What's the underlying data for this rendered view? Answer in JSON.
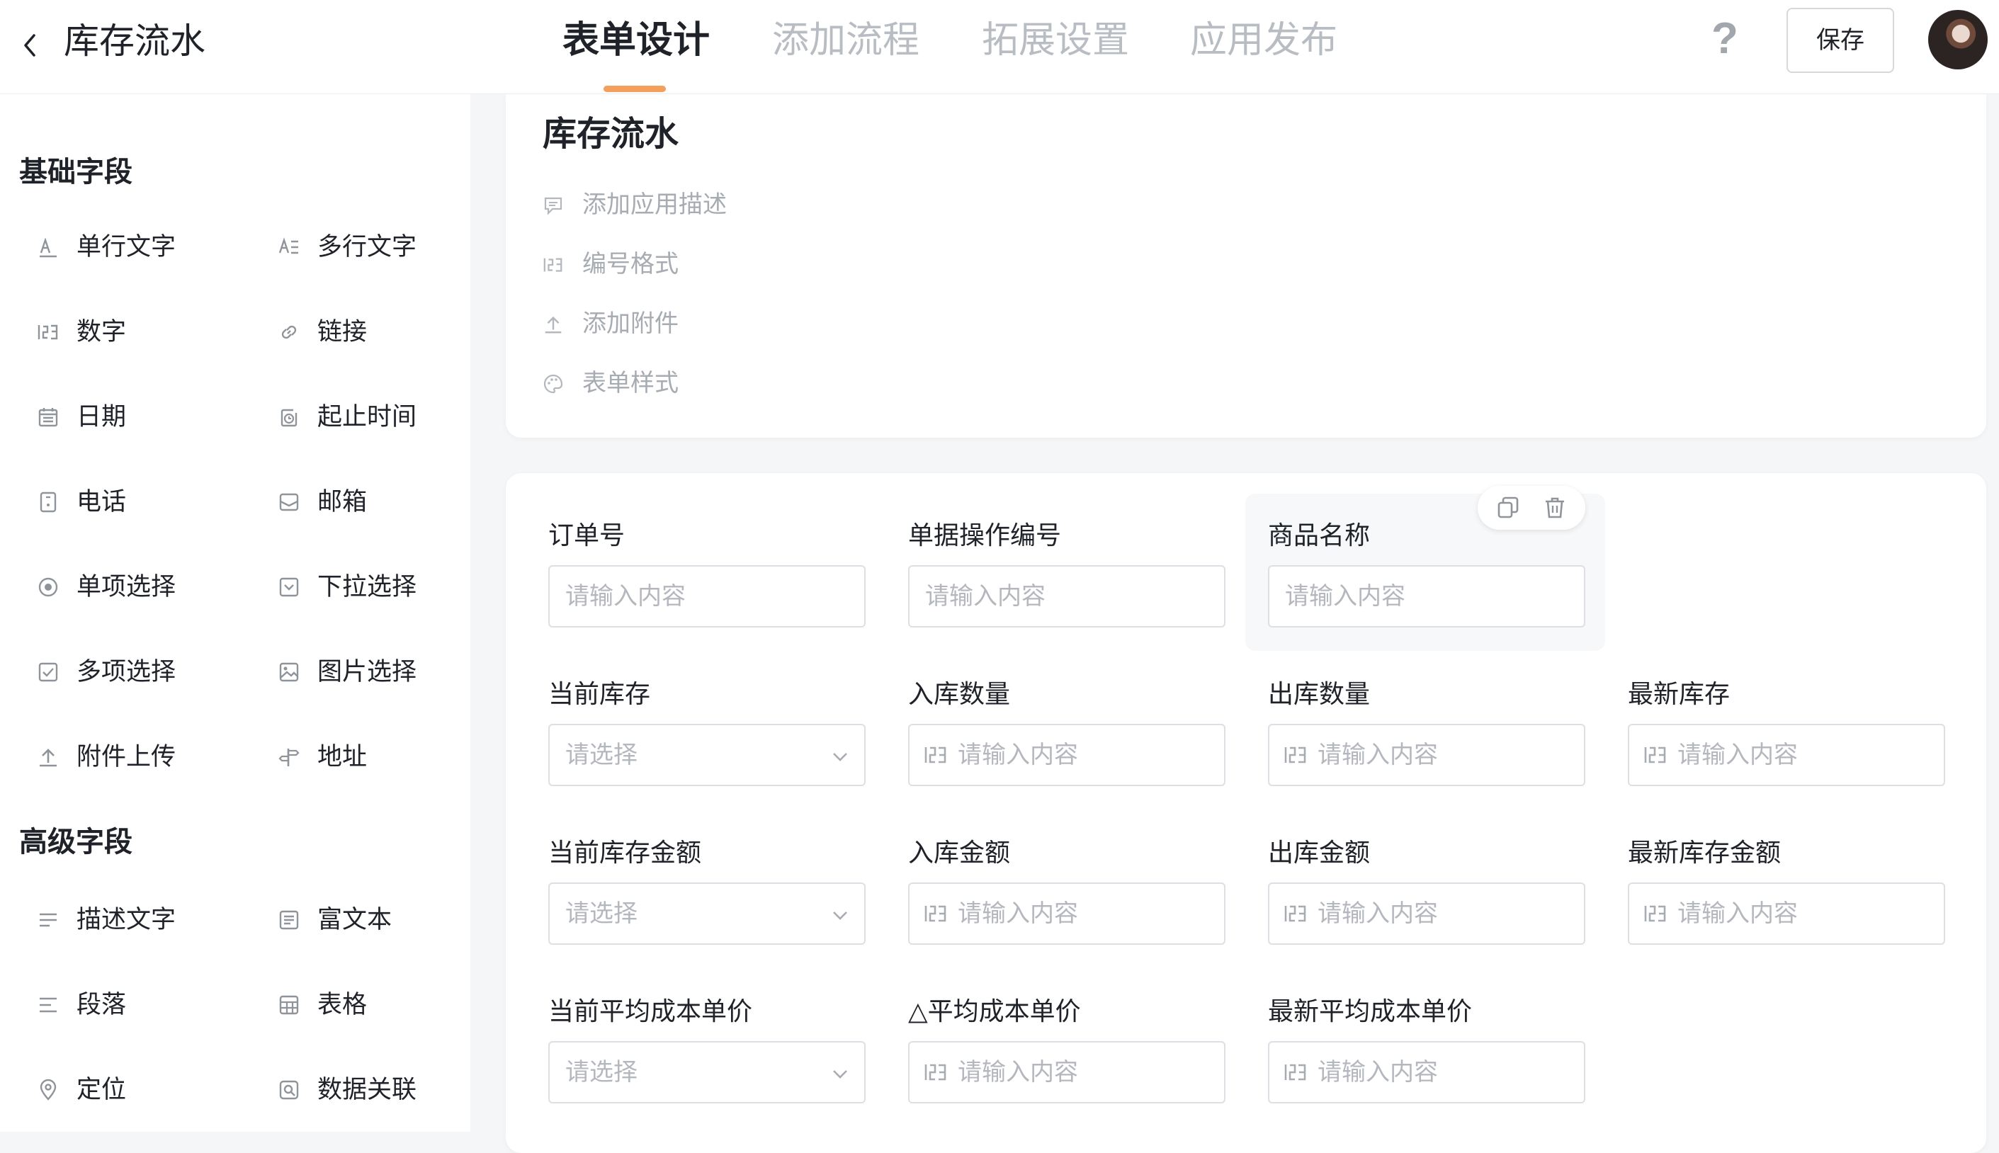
{
  "header": {
    "back_label": "",
    "app_title": "库存流水",
    "tabs": [
      {
        "label": "表单设计",
        "active": true
      },
      {
        "label": "添加流程",
        "active": false
      },
      {
        "label": "拓展设置",
        "active": false
      },
      {
        "label": "应用发布",
        "active": false
      }
    ],
    "help_label": "?",
    "save_label": "保存"
  },
  "sidebar": {
    "basic_title": "基础字段",
    "basic_items": [
      {
        "label": "单行文字",
        "icon": "single-line-text-icon"
      },
      {
        "label": "多行文字",
        "icon": "multi-line-text-icon"
      },
      {
        "label": "数字",
        "icon": "number-icon"
      },
      {
        "label": "链接",
        "icon": "link-icon"
      },
      {
        "label": "日期",
        "icon": "date-icon"
      },
      {
        "label": "起止时间",
        "icon": "time-range-icon"
      },
      {
        "label": "电话",
        "icon": "phone-icon"
      },
      {
        "label": "邮箱",
        "icon": "mail-icon"
      },
      {
        "label": "单项选择",
        "icon": "radio-icon"
      },
      {
        "label": "下拉选择",
        "icon": "dropdown-icon"
      },
      {
        "label": "多项选择",
        "icon": "checkbox-icon"
      },
      {
        "label": "图片选择",
        "icon": "image-icon"
      },
      {
        "label": "附件上传",
        "icon": "upload-icon"
      },
      {
        "label": "地址",
        "icon": "signpost-icon"
      }
    ],
    "advanced_title": "高级字段",
    "advanced_items": [
      {
        "label": "描述文字",
        "icon": "description-icon"
      },
      {
        "label": "富文本",
        "icon": "rich-text-icon"
      },
      {
        "label": "段落",
        "icon": "paragraph-icon"
      },
      {
        "label": "表格",
        "icon": "table-icon"
      },
      {
        "label": "定位",
        "icon": "location-pin-icon"
      },
      {
        "label": "数据关联",
        "icon": "data-link-icon"
      }
    ]
  },
  "form_header": {
    "title": "库存流水",
    "meta_items": [
      {
        "label": "添加应用描述",
        "icon": "comment-icon"
      },
      {
        "label": "编号格式",
        "icon": "number-icon"
      },
      {
        "label": "添加附件",
        "icon": "upload-icon"
      },
      {
        "label": "表单样式",
        "icon": "palette-icon"
      }
    ]
  },
  "form_fields": [
    {
      "label": "订单号",
      "type": "text",
      "placeholder": "请输入内容"
    },
    {
      "label": "单据操作编号",
      "type": "text",
      "placeholder": "请输入内容"
    },
    {
      "label": "商品名称",
      "type": "text",
      "placeholder": "请输入内容",
      "selected": true
    },
    {
      "label": "当前库存",
      "type": "select",
      "placeholder": "请选择"
    },
    {
      "label": "入库数量",
      "type": "number",
      "placeholder": "请输入内容"
    },
    {
      "label": "出库数量",
      "type": "number",
      "placeholder": "请输入内容"
    },
    {
      "label": "最新库存",
      "type": "number",
      "placeholder": "请输入内容"
    },
    {
      "label": "当前库存金额",
      "type": "select",
      "placeholder": "请选择"
    },
    {
      "label": "入库金额",
      "type": "number",
      "placeholder": "请输入内容"
    },
    {
      "label": "出库金额",
      "type": "number",
      "placeholder": "请输入内容"
    },
    {
      "label": "最新库存金额",
      "type": "number",
      "placeholder": "请输入内容"
    },
    {
      "label": "当前平均成本单价",
      "type": "select",
      "placeholder": "请选择"
    },
    {
      "label": "△平均成本单价",
      "type": "number",
      "placeholder": "请输入内容"
    },
    {
      "label": "最新平均成本单价",
      "type": "number",
      "placeholder": "请输入内容"
    }
  ],
  "field_tools": {
    "copy_icon": "copy-icon",
    "delete_icon": "trash-icon"
  },
  "colors": {
    "accent": "#f5a05a",
    "page_bg": "#f5f6f8",
    "muted_text": "#a7abb2",
    "placeholder": "#b4b8be"
  }
}
